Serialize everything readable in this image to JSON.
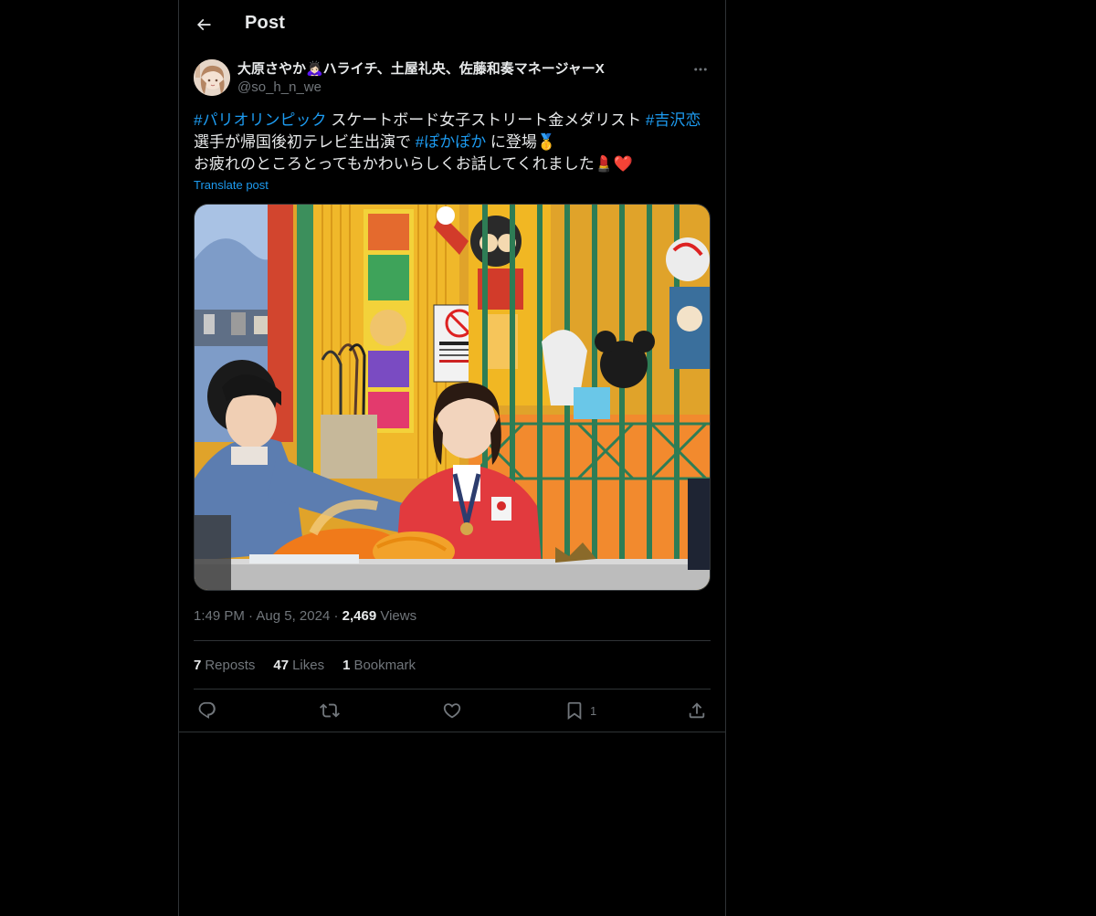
{
  "header": {
    "title": "Post",
    "back_icon": "arrow-left-icon"
  },
  "post": {
    "author": {
      "display_name": "大原さやか🙇🏻‍♀️ハライチ、土屋礼央、佐藤和奏マネージャーX",
      "handle": "@so_h_n_we"
    },
    "text": {
      "line1_tag1": "#パリオリンピック",
      "line1_mid": " スケートボード女子ストリート金メダリスト ",
      "line1_tag2": "#吉沢恋",
      "line2_start": "選手が帰国後初テレビ生出演で ",
      "line2_tag": "#ぽかぽか",
      "line2_end": " に登場🥇",
      "line3": "お疲れのところとってもかわいらしくお話してくれました💄❤️"
    },
    "translate_label": "Translate post",
    "time": "1:49 PM",
    "date": "Aug 5, 2024",
    "views_count": "2,469",
    "views_label": "Views",
    "stats": {
      "reposts_count": "7",
      "reposts_label": "Reposts",
      "likes_count": "47",
      "likes_label": "Likes",
      "bookmarks_count": "1",
      "bookmarks_label": "Bookmark"
    },
    "actions": {
      "bookmark_count": "1"
    }
  },
  "colors": {
    "background": "#000000",
    "text": "#e7e9ea",
    "muted": "#71767b",
    "link": "#1d9bf0",
    "border": "#2f3336"
  }
}
